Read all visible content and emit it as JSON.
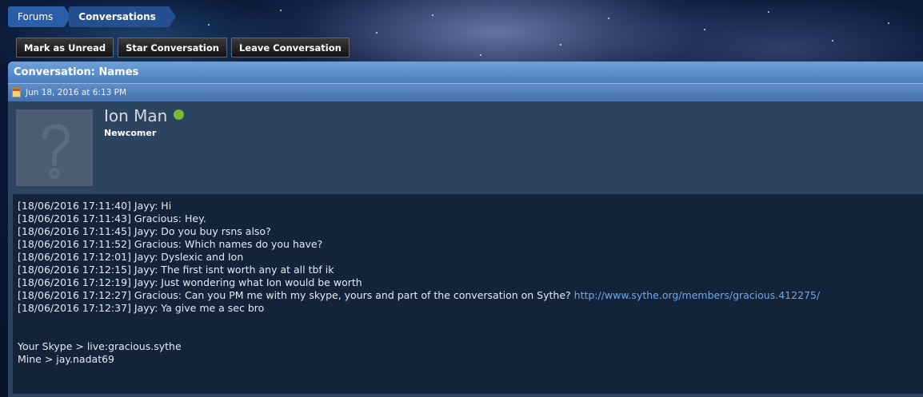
{
  "breadcrumb": [
    "Forums",
    "Conversations"
  ],
  "actions": {
    "mark_unread": "Mark as Unread",
    "star": "Star Conversation",
    "leave": "Leave Conversation"
  },
  "panel": {
    "title": "Conversation: Names",
    "date": "Jun 18, 2016 at 6:13 PM"
  },
  "author": {
    "name": "Ion Man",
    "rank": "Newcomer",
    "status_color": "#7bb82a"
  },
  "message": {
    "lines": [
      "[18/06/2016 17:11:40] Jayy: Hi",
      "[18/06/2016 17:11:43] Gracious: Hey.",
      "[18/06/2016 17:11:45] Jayy: Do you buy rsns also?",
      "[18/06/2016 17:11:52] Gracious: Which names do you have?",
      "[18/06/2016 17:12:01] Jayy: Dyslexic and Ion",
      "[18/06/2016 17:12:15] Jayy: The first isnt worth any at all tbf ik",
      "[18/06/2016 17:12:19] Jayy: Just wondering what Ion would be worth",
      "[18/06/2016 17:12:27] Gracious: Can you PM me with my skype, yours and part of the conversation on Sythe?",
      "[18/06/2016 17:12:37] Jayy: Ya give me a sec bro"
    ],
    "link": "http://www.sythe.org/members/gracious.412275/",
    "footer": [
      "Your Skype > live:gracious.sythe",
      "Mine > jay.nadat69"
    ]
  }
}
